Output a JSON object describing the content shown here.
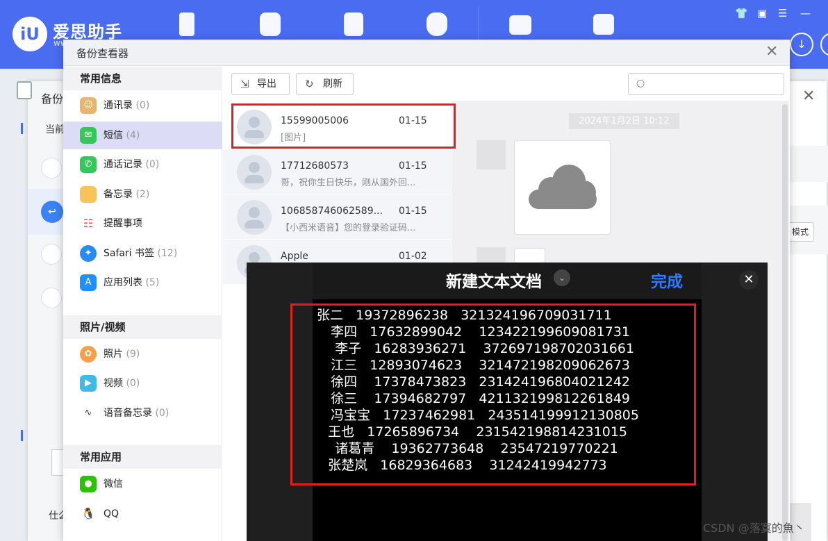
{
  "app": {
    "logo_mark": "iU",
    "logo_text": "爱思助手",
    "logo_sub": "ww",
    "window_controls": [
      "👕",
      "▣",
      "☰",
      "—"
    ],
    "round_buttons": [
      "↓",
      "✕"
    ]
  },
  "background_window": {
    "title": "备份",
    "current_label": "当前",
    "mode_button": "模式",
    "bottom_text": "仕么"
  },
  "dialog": {
    "title": "备份查看器",
    "close": "✕",
    "sections": [
      {
        "header": "常用信息",
        "items": [
          {
            "label": "通讯录",
            "count": "(0)",
            "icon": "contacts-icon",
            "color": "#e8b56a"
          },
          {
            "label": "短信",
            "count": "(4)",
            "icon": "messages-icon",
            "color": "#34c759",
            "active": true
          },
          {
            "label": "通话记录",
            "count": "(0)",
            "icon": "phone-icon",
            "color": "#34c759"
          },
          {
            "label": "备忘录",
            "count": "(2)",
            "icon": "notes-icon",
            "color": "#f7c35a"
          },
          {
            "label": "提醒事项",
            "count": "",
            "icon": "reminders-icon",
            "color": "#ffffff"
          },
          {
            "label": "Safari 书签",
            "count": "(12)",
            "icon": "safari-icon",
            "color": "#2a8cf0"
          },
          {
            "label": "应用列表",
            "count": "(5)",
            "icon": "appstore-icon",
            "color": "#1e90ff"
          }
        ]
      },
      {
        "header": "照片/视频",
        "items": [
          {
            "label": "照片",
            "count": "(9)",
            "icon": "photos-icon",
            "color": "#f6a14a"
          },
          {
            "label": "视频",
            "count": "(0)",
            "icon": "video-icon",
            "color": "#3dbbe6"
          },
          {
            "label": "语音备忘录",
            "count": "(0)",
            "icon": "voice-memo-icon",
            "color": "#ffffff"
          }
        ]
      },
      {
        "header": "常用应用",
        "items": [
          {
            "label": "微信",
            "count": "",
            "icon": "wechat-icon",
            "color": "#2dc100"
          },
          {
            "label": "QQ",
            "count": "",
            "icon": "qq-icon",
            "color": "#ffffff"
          }
        ]
      }
    ],
    "toolbar": {
      "export_label": "导出",
      "refresh_label": "刷新",
      "search_placeholder": ""
    },
    "messages": [
      {
        "name": "15599005006",
        "date": "01-15",
        "preview": "[图片]"
      },
      {
        "name": "17712680573",
        "date": "01-15",
        "preview": "哥，祝你生日快乐，刚从国外回..."
      },
      {
        "name": "106858746062589...",
        "date": "01-15",
        "preview": "【小西米语音】您的登录验证码..."
      },
      {
        "name": "Apple",
        "date": "01-02",
        "preview": ""
      }
    ],
    "chat": {
      "timestamp": "2024年1月2日 10:12"
    }
  },
  "doc_viewer": {
    "title": "新建文本文档",
    "done_label": "完成",
    "close": "✕",
    "lines": [
      "张二   19372896238   321324196709031711",
      "    李四   17632899042    123422199609081731",
      "     李子   16283936271    372697198702031661",
      "    江三   12893074623    321472198209062673",
      "    徐四    17378473823   231424196804021242",
      "    徐三    17394682797   421132199812261849",
      "    冯宝宝   17237462981   243514199912130805",
      "    王也   17265896734    231542198814231015",
      "     诸葛青    19362773648    23547219770221",
      "    张楚岚   16829364683    31242419942773"
    ]
  },
  "watermark": "CSDN @落寞的魚丶"
}
